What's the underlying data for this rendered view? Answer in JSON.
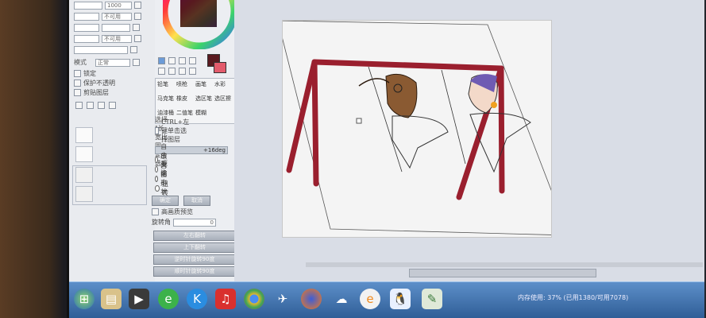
{
  "tools_panel": {
    "brush_size_text": "1000",
    "dropdowns": [
      "不可用",
      "不可用"
    ],
    "blend_mode": "正常",
    "lock_labels": [
      "锁定",
      "保护不透明",
      "剪贴图层"
    ]
  },
  "middle_panel": {
    "tool_grid": [
      "铅笔",
      "喷枪",
      "画笔",
      "水彩",
      "马克笔",
      "橡皮",
      "选区笔",
      "选区擦",
      "油漆桶",
      "二值笔",
      "模糊"
    ],
    "ctrl_hint": "CTRL+左键单击选择图层",
    "transform_hint": "选择 \"长宽比固定\" 选项",
    "angle_value": "+16deg",
    "radio_options": [
      {
        "label": "自由变换",
        "selected": false
      },
      {
        "label": "放大缩小",
        "selected": false
      },
      {
        "label": "自由形状",
        "selected": true
      },
      {
        "label": "扭转",
        "selected": false
      }
    ],
    "ok_label": "确定",
    "cancel_label": "取消",
    "checkbox_label": "高画质预览",
    "offset_label": "旋转角",
    "offset_value": "0",
    "action_buttons": [
      "左右翻转",
      "上下翻转",
      "逆时针旋转90度",
      "顺时针旋转90度"
    ]
  },
  "taskbar": {
    "icons": [
      "start-orb-icon",
      "explorer-icon",
      "media-icon",
      "360-icon",
      "kugou-icon",
      "netease-music-icon",
      "chrome-icon",
      "bird-app-icon",
      "firefox-icon",
      "network-icon",
      "ie-icon",
      "qq-icon",
      "sai-icon"
    ],
    "status_text": "内存使用: 37% (已用1380/可用7078)"
  },
  "colors": {
    "swing_red": "#9a1f2e",
    "taskbar_blue": "#3a6aa8"
  }
}
